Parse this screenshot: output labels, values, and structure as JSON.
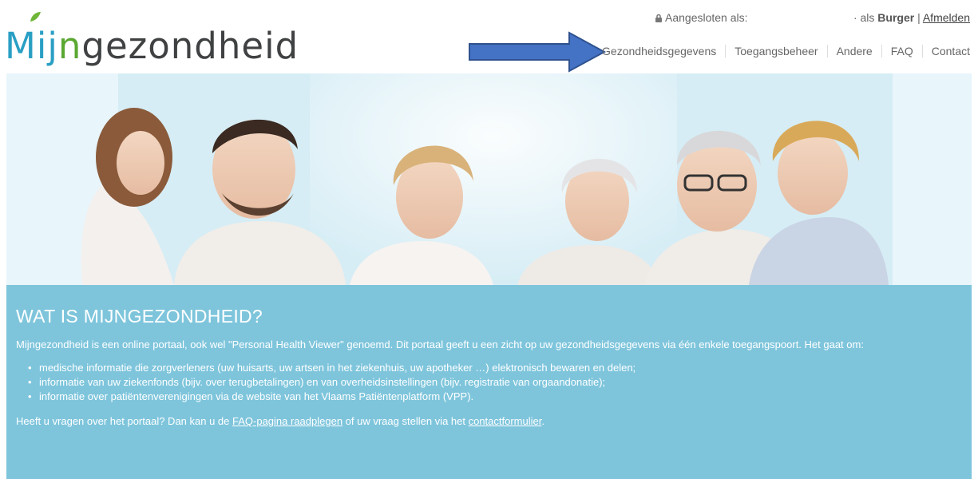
{
  "logo": {
    "part1": "Mij",
    "part2": "n",
    "part3": "gezondheid"
  },
  "login": {
    "prefix": "Aangesloten als:",
    "role_prefix": "· als",
    "role": "Burger",
    "separator": "|",
    "logout": "Afmelden"
  },
  "nav": {
    "items": [
      {
        "label": "Gezondheidsgegevens"
      },
      {
        "label": "Toegangsbeheer"
      },
      {
        "label": "Andere"
      },
      {
        "label": "FAQ"
      },
      {
        "label": "Contact"
      }
    ]
  },
  "colors": {
    "info_bg": "#7ec5dc",
    "arrow": "#4472c4",
    "logo_blue": "#2a9fc4",
    "logo_green": "#5aa832"
  },
  "info": {
    "heading": "WAT IS MIJNGEZONDHEID?",
    "intro": "Mijngezondheid is een online portaal, ook wel \"Personal Health Viewer\" genoemd. Dit portaal geeft u een zicht op uw gezondheidsgegevens via één enkele toegangspoort. Het gaat om:",
    "bullets": [
      "medische informatie die zorgverleners (uw huisarts, uw artsen in het ziekenhuis, uw apotheker …) elektronisch bewaren en delen;",
      "informatie van uw ziekenfonds (bijv. over terugbetalingen) en van overheidsinstellingen (bijv. registratie van orgaandonatie);",
      "informatie over patiëntenverenigingen via de website van het Vlaams Patiëntenplatform (VPP)."
    ],
    "question_1": "Heeft u vragen over het portaal? Dan kan u de ",
    "faq_link": "FAQ-pagina raadplegen",
    "question_2": " of uw vraag stellen via het ",
    "contact_link": "contactformulier",
    "question_3": "."
  }
}
